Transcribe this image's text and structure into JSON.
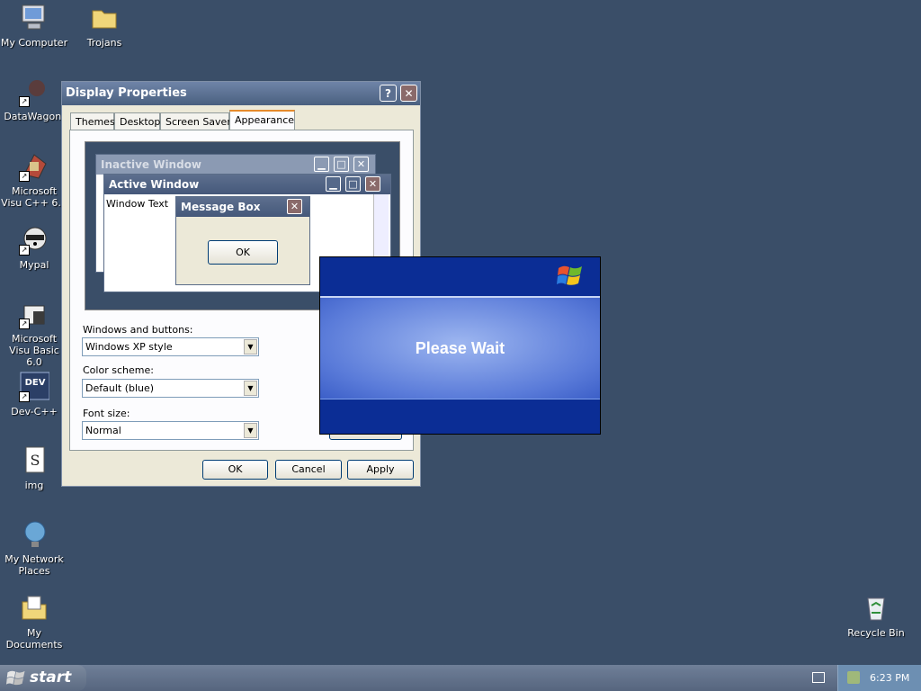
{
  "desktop": {
    "icons": [
      {
        "name": "My Computer",
        "glyph": "🖥"
      },
      {
        "name": "Trojans",
        "glyph": "📁"
      },
      {
        "name": "DataWagon.",
        "glyph": "●"
      },
      {
        "name": "Microsoft Visu C++ 6.0",
        "glyph": "⬣"
      },
      {
        "name": "Mypal",
        "glyph": "🦝"
      },
      {
        "name": "Microsoft Visu Basic 6.0",
        "glyph": "⚙"
      },
      {
        "name": "Dev-C++",
        "glyph": "DEV"
      },
      {
        "name": "img",
        "glyph": "S"
      },
      {
        "name": "My Network Places",
        "glyph": "🌐"
      },
      {
        "name": "My Documents",
        "glyph": "📄"
      },
      {
        "name": "Recycle Bin",
        "glyph": "♻"
      }
    ]
  },
  "dialog": {
    "title": "Display Properties",
    "help_glyph": "?",
    "close_glyph": "✕",
    "tabs": [
      "Themes",
      "Desktop",
      "Screen Saver",
      "Appearance"
    ],
    "active_tab": "Appearance",
    "preview": {
      "inactive_title": "Inactive Window",
      "active_title": "Active Window",
      "window_text": "Window Text",
      "message_title": "Message Box",
      "message_ok": "OK"
    },
    "windows_buttons_label": "Windows and buttons:",
    "windows_buttons_value": "Windows XP style",
    "color_scheme_label": "Color scheme:",
    "color_scheme_value": "Default (blue)",
    "font_size_label": "Font size:",
    "font_size_value": "Normal",
    "ok": "OK",
    "cancel": "Cancel",
    "apply": "Apply"
  },
  "wait": {
    "message": "Please Wait"
  },
  "taskbar": {
    "start": "start",
    "time": "6:23 PM"
  }
}
